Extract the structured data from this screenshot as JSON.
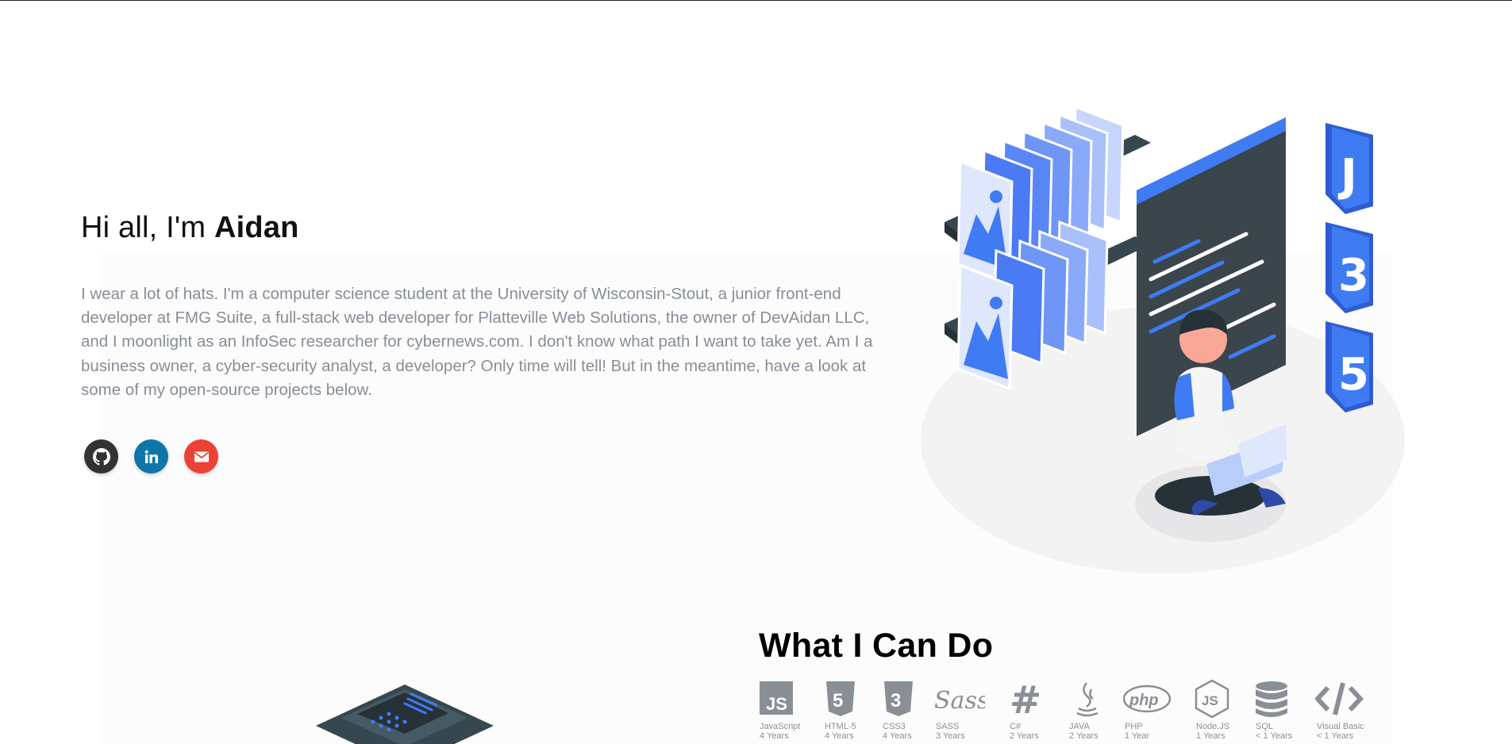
{
  "greeting": {
    "prefix": "Hi all, I'm ",
    "name": "Aidan"
  },
  "bio": "I wear a lot of hats. I'm a computer science student at the University of Wisconsin-Stout, a junior front-end developer at FMG Suite, a full-stack web developer for Platteville Web Solutions, the owner of DevAidan LLC, and I moonlight as an InfoSec researcher for cybernews.com. I don't know what path I want to take yet. Am I a business owner, a cyber-security analyst, a developer? Only time will tell! But in the meantime, have a look at some of my open-source projects below.",
  "socials": [
    {
      "icon": "github-icon",
      "color": "#333333"
    },
    {
      "icon": "linkedin-icon",
      "color": "#0e76a8"
    },
    {
      "icon": "email-icon",
      "color": "#ea4335"
    }
  ],
  "skills_section": {
    "title": "What I Can Do",
    "skills": [
      {
        "name": "JavaScript",
        "years": "4 Years",
        "icon": "javascript-icon"
      },
      {
        "name": "HTML-5",
        "years": "4 Years",
        "icon": "html5-icon"
      },
      {
        "name": "CSS3",
        "years": "4 Years",
        "icon": "css3-icon"
      },
      {
        "name": "SASS",
        "years": "3 Years",
        "icon": "sass-icon"
      },
      {
        "name": "C#",
        "years": "2 Years",
        "icon": "csharp-icon"
      },
      {
        "name": "JAVA",
        "years": "2 Years",
        "icon": "java-icon"
      },
      {
        "name": "PHP",
        "years": "1 Year",
        "icon": "php-icon"
      },
      {
        "name": "Node.JS",
        "years": "1 Years",
        "icon": "nodejs-icon"
      },
      {
        "name": "SQL",
        "years": "< 1 Years",
        "icon": "database-icon"
      },
      {
        "name": "Visual Basic",
        "years": "< 1 Years",
        "icon": "code-icon"
      }
    ]
  },
  "colors": {
    "accent": "#3f7cf4",
    "text": "#000000",
    "muted": "#868e96"
  }
}
